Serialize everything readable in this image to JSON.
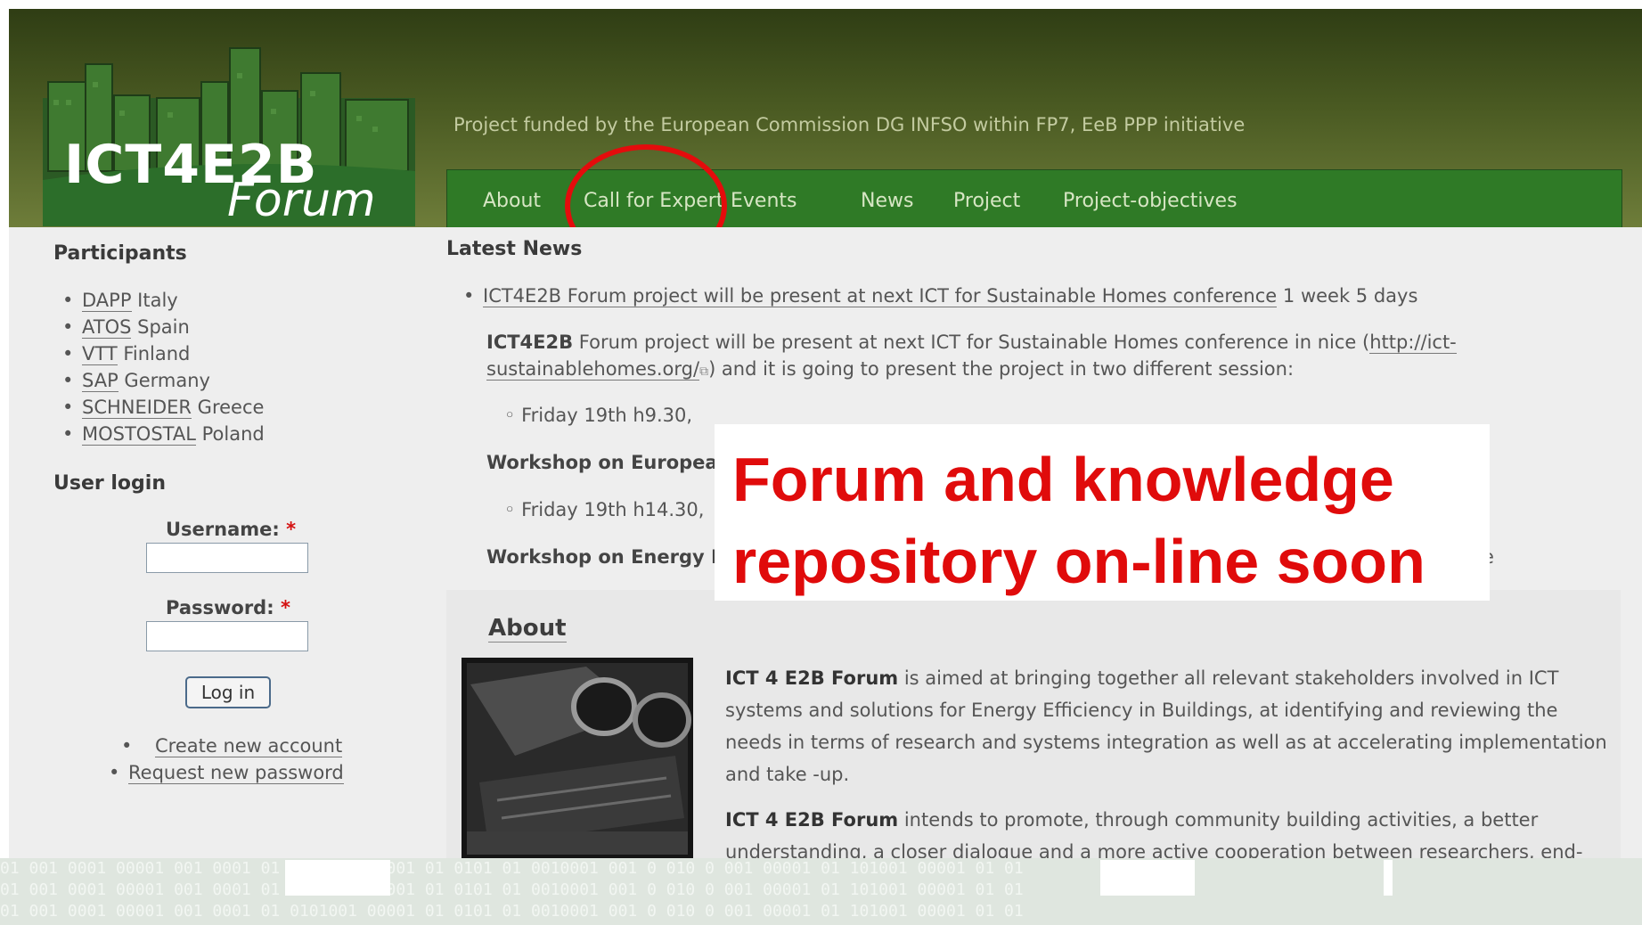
{
  "header": {
    "logo_title": "ICT4E2B",
    "logo_subtitle": "Forum",
    "tagline": "Project funded by the European Commission DG INFSO within FP7, EeB PPP initiative"
  },
  "nav": {
    "items": [
      "About",
      "Call for Expert",
      "Events",
      "News",
      "Project",
      "Project-objectives"
    ]
  },
  "sidebar": {
    "participants_title": "Participants",
    "participants": [
      {
        "link": "DAPP",
        "rest": " Italy"
      },
      {
        "link": "ATOS",
        "rest": " Spain"
      },
      {
        "link": "VTT",
        "rest": " Finland"
      },
      {
        "link": "SAP",
        "rest": " Germany"
      },
      {
        "link": "SCHNEIDER",
        "rest": " Greece"
      },
      {
        "link": "MOSTOSTAL",
        "rest": " Poland"
      }
    ],
    "login_title": "User login",
    "username_label": "Username:",
    "password_label": "Password:",
    "required_mark": "*",
    "login_button": "Log in",
    "links": [
      "Create new account",
      "Request new password"
    ]
  },
  "news": {
    "title": "Latest News",
    "item_link": "ICT4E2B Forum project will be present at next ICT for Sustainable Homes conference",
    "item_age": "1 week 5 days",
    "body_bold": "ICT4E2B",
    "body_text1": " Forum project will be present at next ICT for Sustainable Homes conference in nice (",
    "body_url": "http://ict-sustainablehomes.org/",
    "body_text2": ") and it is going to present the project in two different session:",
    "session1_time": "Friday 19th h9.30,",
    "session1_title": "Workshop on Europea",
    "session2_time": "Friday 19th h14.30,",
    "session2_title": "Workshop on Energy E",
    "trailing_char": "e"
  },
  "overlay": {
    "line1": "Forum and knowledge",
    "line2": "repository on-line soon"
  },
  "about": {
    "title": "About",
    "p1_bold": "ICT 4 E2B Forum",
    "p1_text": " is aimed at bringing together all relevant stakeholders involved in ICT systems and solutions for Energy Efficiency in Buildings, at identifying and reviewing the needs in terms of research and systems integration as well as at accelerating implementation and take -up.",
    "p2_bold": "ICT 4 E2B Forum",
    "p2_text": " intends to promote, through community building activities, a better understanding, a closer dialogue and a more active cooperation between researchers, end-"
  },
  "footer_binary": "01 001 0001   00001 001 0001  01  0101001 00001 01 0101 01  0010001 001 0 010  0 001 00001 01  101001 00001 01 01",
  "colors": {
    "accent_red": "#e00b0b",
    "nav_green": "#2f7a26",
    "header_olive": "#4a5a22"
  }
}
